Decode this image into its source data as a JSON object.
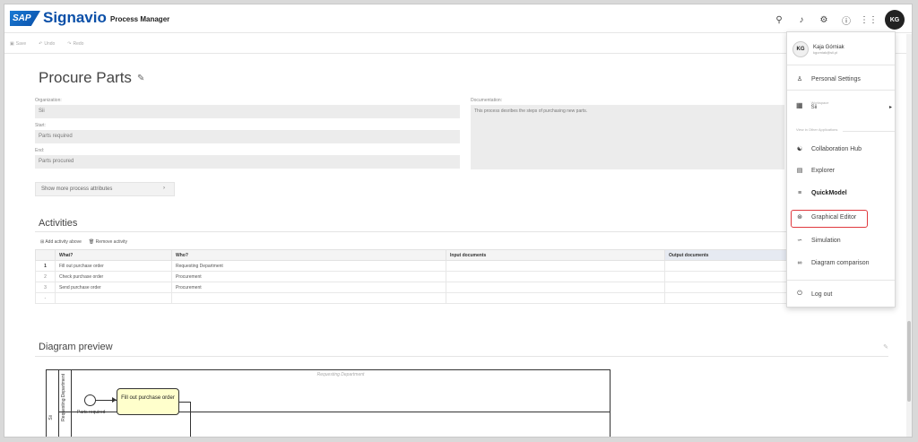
{
  "header": {
    "logo_text": "SAP",
    "brand": "Signavio",
    "app_name": "Process Manager",
    "avatar_initials": "KG"
  },
  "toolbar": {
    "save": "Save",
    "undo": "Undo",
    "redo": "Redo"
  },
  "process": {
    "title": "Procure Parts",
    "organization_label": "Organization:",
    "organization": "Sii",
    "start_label": "Start:",
    "start": "Parts required",
    "end_label": "End:",
    "end": "Parts procured",
    "documentation_label": "Documentation:",
    "documentation": "This process desribes the steps of purchasing new parts.",
    "more_attributes": "Show more process attributes"
  },
  "activities": {
    "title": "Activities",
    "add_above": "Add activity above",
    "remove": "Remove activity",
    "columns": [
      "What?",
      "Who?",
      "Input documents",
      "Output documents"
    ],
    "rows": [
      {
        "num": "1",
        "what": "Fill out purchase order",
        "who": "Requesting Department"
      },
      {
        "num": "2",
        "what": "Check purchase order",
        "who": "Procurement"
      },
      {
        "num": "3",
        "what": "Send purchase order",
        "who": "Procurement"
      },
      {
        "num": "-",
        "what": "",
        "who": ""
      }
    ]
  },
  "diagram": {
    "title": "Diagram preview",
    "pool_label": "Sii",
    "lane_label": "Requesting Department",
    "lane_header": "Requesting Department",
    "start_event_label": "Parts required",
    "task_label": "Fill out purchase order"
  },
  "user_menu": {
    "initials": "KG",
    "name": "Kaja Górniak",
    "email": "kgorniak@sii.pl",
    "personal_settings": "Personal Settings",
    "workspace_label": "Workspace",
    "workspace_value": "Sii",
    "other_apps_label": "View in Other Applications",
    "items": [
      "Collaboration Hub",
      "Explorer",
      "QuickModel",
      "Graphical Editor",
      "Simulation",
      "Diagram comparison"
    ],
    "logout": "Log out"
  }
}
